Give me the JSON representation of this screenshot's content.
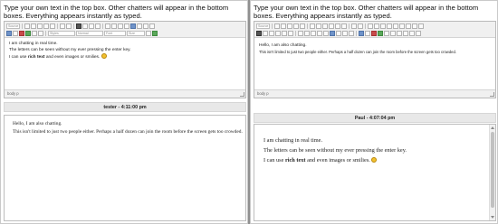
{
  "instructions": "Type your own text in the top box. Other chatters will appear in the bottom boxes. Everything appears instantly as typed.",
  "toolbar": {
    "style_combo": "Styles",
    "format_combo": "Normal",
    "font_combo": "Font",
    "size_combo": "Size",
    "source_label": "Source"
  },
  "left": {
    "editor_lines": [
      "I am chatting in real time.",
      "The letters can be seen without my ever pressing the enter key.",
      "I can use rich text and even images or smilies."
    ],
    "status": "body p",
    "remote": {
      "name_time": "tester - 4:11:00 pm",
      "lines": [
        "Hello, I am also chatting.",
        "This isn't limited to just two people either. Perhaps a half dozen can join the room before the screen gets too crowded."
      ]
    }
  },
  "right": {
    "editor_lines": [
      "Hello, I am also chatting.",
      "This isn't limited to just two people either. Perhaps a half dozen can join the room before the screen gets too crowded."
    ],
    "status": "body p",
    "remote": {
      "name_time": "Paul - 4:07:04 pm",
      "lines": [
        "I am chatting in real time.",
        "The letters can be seen without my ever pressing the enter key."
      ],
      "rich_line": {
        "before": "I can use ",
        "bold": "rich text",
        "after": " and even images or smilies. "
      }
    }
  },
  "colors": {
    "divider": "#8f8f8f",
    "header_bg": "#e8e8e8",
    "smiley": "#f2c12e"
  }
}
